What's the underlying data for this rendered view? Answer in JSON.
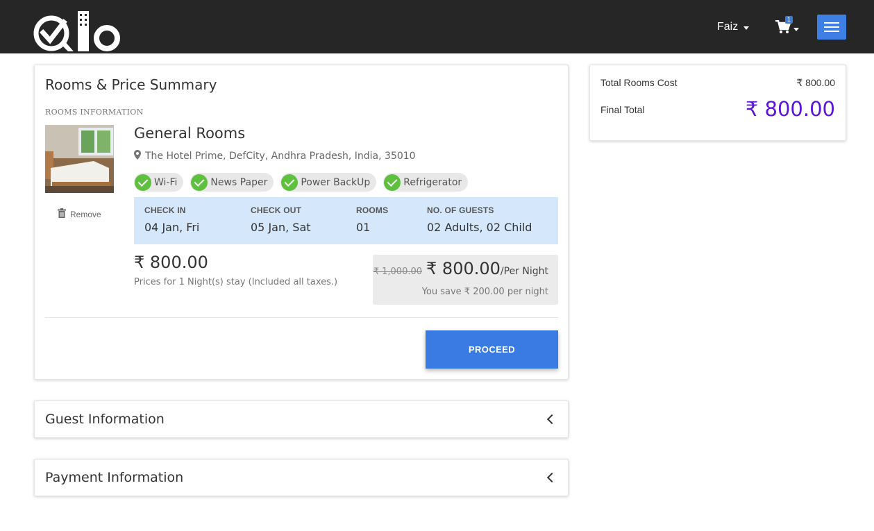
{
  "header": {
    "brand": "Qlo",
    "user_name": "Faiz",
    "cart_count": "1",
    "icons": [
      "logo",
      "caret-down-icon",
      "cart-icon",
      "hamburger-icon"
    ]
  },
  "summary": {
    "title": "Rooms & Price Summary",
    "section_label": "ROOMS INFORMATION",
    "room_name": "General Rooms",
    "address": "The Hotel Prime, DefCity, Andhra Pradesh, India, 35010",
    "remove_label": "Remove",
    "features": [
      "Wi-Fi",
      "News Paper",
      "Power BackUp",
      "Refrigerator"
    ],
    "booking": {
      "check_in_label": "CHECK IN",
      "check_in": "04 Jan, Fri",
      "check_out_label": "CHECK OUT",
      "check_out": "05 Jan, Sat",
      "rooms_label": "ROOMS",
      "rooms": "01",
      "guests_label": "NO. OF GUESTS",
      "guests": "02 Adults, 02 Child"
    },
    "total_price": "₹ 800.00",
    "price_note": "Prices for 1 Night(s) stay (Included all taxes.)",
    "old_price": "₹ 1,000.00",
    "new_price": "₹ 800.00",
    "per_night": "/Per Night",
    "save_note": "You save ₹ 200.00 per night",
    "proceed_label": "PROCEED"
  },
  "side": {
    "rooms_cost_label": "Total Rooms Cost",
    "rooms_cost": "₹ 800.00",
    "final_label": "Final Total",
    "final_total": "₹ 800.00"
  },
  "guest": {
    "title": "Guest Information"
  },
  "payment": {
    "title": "Payment Information"
  },
  "colors": {
    "topbar": "#262626",
    "accent_blue": "#3a7ae3",
    "final_total": "#5a14d8",
    "booking_bg": "#d4e7fb",
    "feature_check": "#5fbf3e"
  }
}
